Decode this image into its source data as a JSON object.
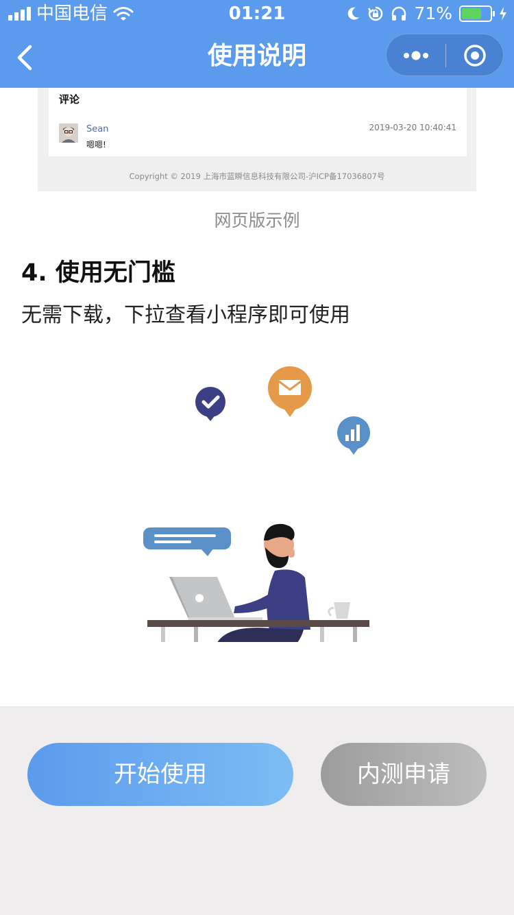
{
  "status_bar": {
    "carrier": "中国电信",
    "time": "01:21",
    "battery_percent": "71%",
    "battery_level": 0.71,
    "icons": [
      "signal-icon",
      "wifi-icon",
      "moon-icon",
      "rotation-lock-icon",
      "headphones-icon",
      "battery-icon",
      "charging-icon"
    ]
  },
  "nav": {
    "title": "使用说明",
    "back_icon": "chevron-left-icon",
    "more_icon": "more-dots-icon",
    "close_icon": "target-circle-icon"
  },
  "web_sample": {
    "section_title": "评论",
    "comment": {
      "user": "Sean",
      "time": "2019-03-20 10:40:41",
      "text": "嗯嗯!"
    },
    "copyright": "Copyright © 2019 上海市蓝瞬信息科技有限公司-沪ICP备17036807号"
  },
  "caption": "网页版示例",
  "section": {
    "heading": "4. 使用无门槛",
    "body": "无需下载，下拉查看小程序即可使用"
  },
  "buttons": {
    "start": "开始使用",
    "apply": "内测申请"
  },
  "colors": {
    "primary": "#5b9bed",
    "primary_light": "#7dbcf3",
    "gray_button": "#a8a8a8",
    "bottom_bg": "#efeded"
  }
}
